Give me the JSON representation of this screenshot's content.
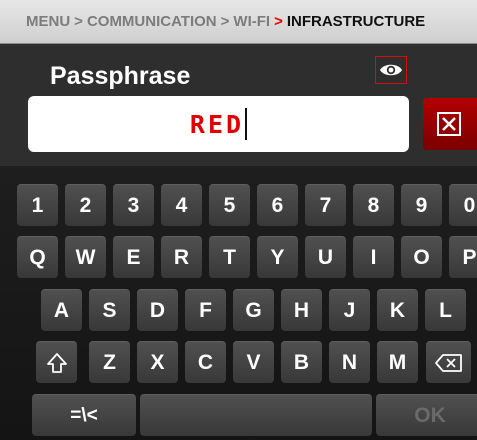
{
  "breadcrumb": {
    "items": [
      "MENU",
      "COMMUNICATION",
      "WI-FI"
    ],
    "separator": ">",
    "current": "INFRASTRUCTURE"
  },
  "field": {
    "title": "Passphrase",
    "value": "RED",
    "show_password_icon": "eye-icon",
    "clear_icon": "clear-icon"
  },
  "keyboard": {
    "row_numbers": [
      "1",
      "2",
      "3",
      "4",
      "5",
      "6",
      "7",
      "8",
      "9",
      "0"
    ],
    "row_top": [
      "Q",
      "W",
      "E",
      "R",
      "T",
      "Y",
      "U",
      "I",
      "O",
      "P"
    ],
    "row_home": [
      "A",
      "S",
      "D",
      "F",
      "G",
      "H",
      "J",
      "K",
      "L"
    ],
    "row_bottom": [
      "Z",
      "X",
      "C",
      "V",
      "B",
      "N",
      "M"
    ],
    "shift_icon": "shift-icon",
    "backspace_icon": "backspace-icon",
    "symbols_label": "=\\<",
    "ok_label": "OK"
  },
  "colors": {
    "accent_red": "#e00000",
    "clear_button": "#9a0000",
    "keyboard_bg": "#1b1b1b",
    "key_bg": "#444444",
    "disabled_text": "#6a6a6a"
  }
}
